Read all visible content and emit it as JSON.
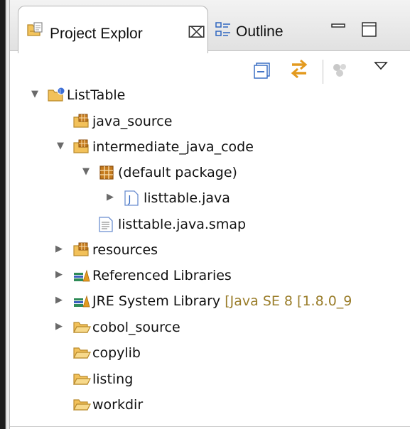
{
  "tabs": [
    {
      "label": "Project Explor",
      "active": true
    },
    {
      "label": "Outline",
      "active": false
    }
  ],
  "icons": {
    "tab_project_explorer": "project-explorer-icon",
    "tab_outline": "outline-icon",
    "close": "close-icon",
    "minimize": "minimize-icon",
    "maximize": "maximize-icon",
    "collapse_all": "collapse-all-icon",
    "link_with_editor": "link-with-editor-icon",
    "view_menu": "view-menu-icon"
  },
  "colors": {
    "decoration": "#9a7d2a",
    "folder": "#f2c15a",
    "package": "#c47a1d",
    "tab_background": "#e1e1e1"
  },
  "tree": [
    {
      "label": "ListTable",
      "expanded": true,
      "icon": "java-project-icon"
    },
    {
      "label": "java_source",
      "icon": "source-folder-icon"
    },
    {
      "label": "intermediate_java_code",
      "expanded": true,
      "icon": "source-folder-icon"
    },
    {
      "label": "(default package)",
      "expanded": true,
      "icon": "package-icon"
    },
    {
      "label": "listtable.java",
      "expanded": false,
      "icon": "java-file-icon"
    },
    {
      "label": "listtable.java.smap",
      "icon": "text-file-icon"
    },
    {
      "label": "resources",
      "expanded": false,
      "icon": "source-folder-icon"
    },
    {
      "label": "Referenced Libraries",
      "expanded": false,
      "icon": "library-icon"
    },
    {
      "label": "JRE System Library",
      "decoration": "[Java SE 8 [1.8.0_9",
      "expanded": false,
      "icon": "library-icon"
    },
    {
      "label": "cobol_source",
      "expanded": false,
      "icon": "folder-icon"
    },
    {
      "label": "copylib",
      "icon": "folder-icon"
    },
    {
      "label": "listing",
      "icon": "folder-icon"
    },
    {
      "label": "workdir",
      "icon": "folder-icon"
    }
  ]
}
